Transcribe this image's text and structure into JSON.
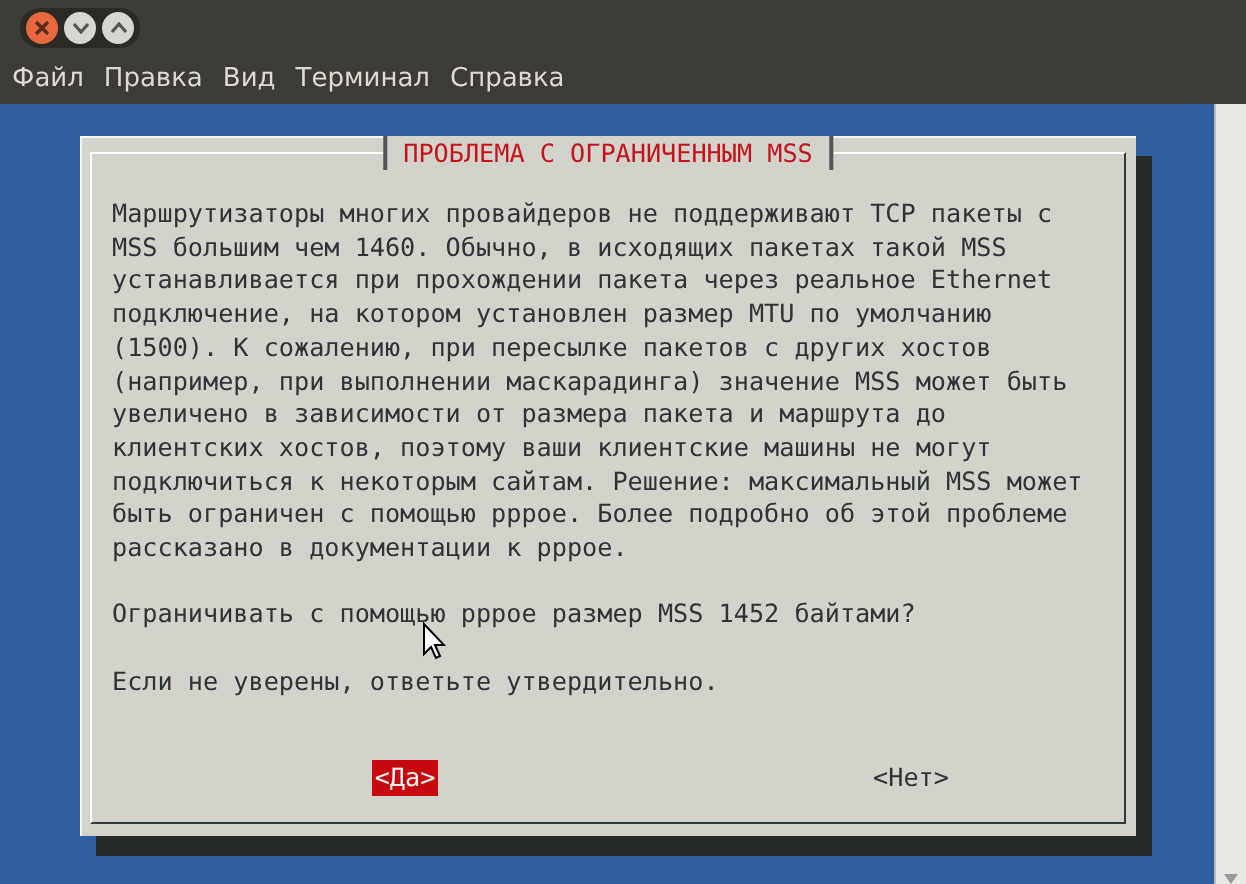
{
  "window": {
    "controls": [
      {
        "kind": "close"
      },
      {
        "kind": "minimize"
      },
      {
        "kind": "maximize"
      }
    ]
  },
  "menu": {
    "items": [
      "Файл",
      "Правка",
      "Вид",
      "Терминал",
      "Справка"
    ]
  },
  "dialog": {
    "title": "ПРОБЛЕМА С ОГРАНИЧЕННЫМ MSS",
    "message_lines": [
      "Маршрутизаторы многих провайдеров не поддерживают TCP пакеты с",
      "MSS большим чем 1460. Обычно, в исходящих пакетах такой MSS",
      "устанавливается при прохождении пакета через реальное Ethernet",
      "подключение, на котором установлен размер MTU по умолчанию",
      "(1500). К сожалению, при пересылке пакетов с других хостов",
      "(например, при выполнении маскарадинга) значение MSS может быть",
      "увеличено в зависимости от размера пакета и маршрута до",
      "клиентских хостов, поэтому ваши клиентские машины не могут",
      "подключиться к некоторым сайтам. Решение: максимальный MSS может",
      "быть ограничен с помощью pppoe. Более подробно об этой проблеме",
      "рассказано в документации к pppoe."
    ],
    "question": "Ограничивать с помощью pppoe размер MSS 1452 байтами?",
    "hint": "Если не уверены, ответьте утвердительно.",
    "buttons": [
      {
        "label": "<Да>",
        "selected": true
      },
      {
        "label": "<Нет>",
        "selected": false
      }
    ]
  }
}
